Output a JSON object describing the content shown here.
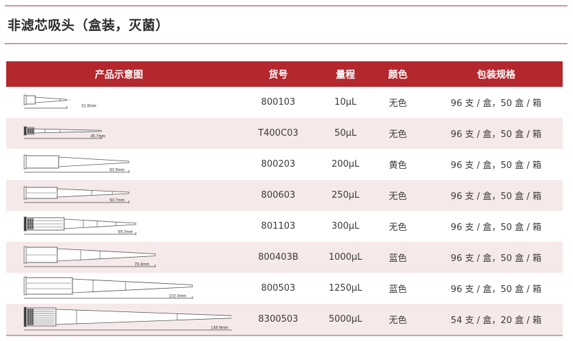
{
  "page": {
    "title": "非滤芯吸头（盒装，灭菌）"
  },
  "table": {
    "headers": {
      "image": "产品示意图",
      "code": "货号",
      "volume": "量程",
      "color": "颜色",
      "package": "包装规格"
    },
    "rows": [
      {
        "code": "800103",
        "volume": "10μL",
        "color": "无色",
        "package": "96 支 / 盒，50 盒 / 箱",
        "length_label": "31.6mm",
        "tip": "10"
      },
      {
        "code": "T400C03",
        "volume": "50μL",
        "color": "无色",
        "package": "96 支 / 盒，50 盒 / 箱",
        "length_label": "45.7mm",
        "tip": "50"
      },
      {
        "code": "800203",
        "volume": "200μL",
        "color": "黄色",
        "package": "96 支 / 盒，50 盒 / 箱",
        "length_label": "50.5mm",
        "tip": "200"
      },
      {
        "code": "800603",
        "volume": "250μL",
        "color": "无色",
        "package": "96 支 / 盒，50 盒 / 箱",
        "length_label": "50.7mm",
        "tip": "250"
      },
      {
        "code": "801103",
        "volume": "300μL",
        "color": "无色",
        "package": "96 支 / 盒，50 盒 / 箱",
        "length_label": "59.2mm",
        "tip": "300"
      },
      {
        "code": "800403B",
        "volume": "1000μL",
        "color": "蓝色",
        "package": "96 支 / 盒，50 盒 / 箱",
        "length_label": "78.4mm",
        "tip": "1000"
      },
      {
        "code": "800503",
        "volume": "1250μL",
        "color": "蓝色",
        "package": "96 支 / 盒，50 盒 / 箱",
        "length_label": "102.0mm",
        "tip": "1250"
      },
      {
        "code": "8300503",
        "volume": "5000μL",
        "color": "无色",
        "package": "54 支 / 盒，20 盒 / 箱",
        "length_label": "149.9mm",
        "tip": "5000"
      }
    ]
  },
  "colors": {
    "accent": "#b3272d",
    "row_shade": "#f6e9e9"
  }
}
